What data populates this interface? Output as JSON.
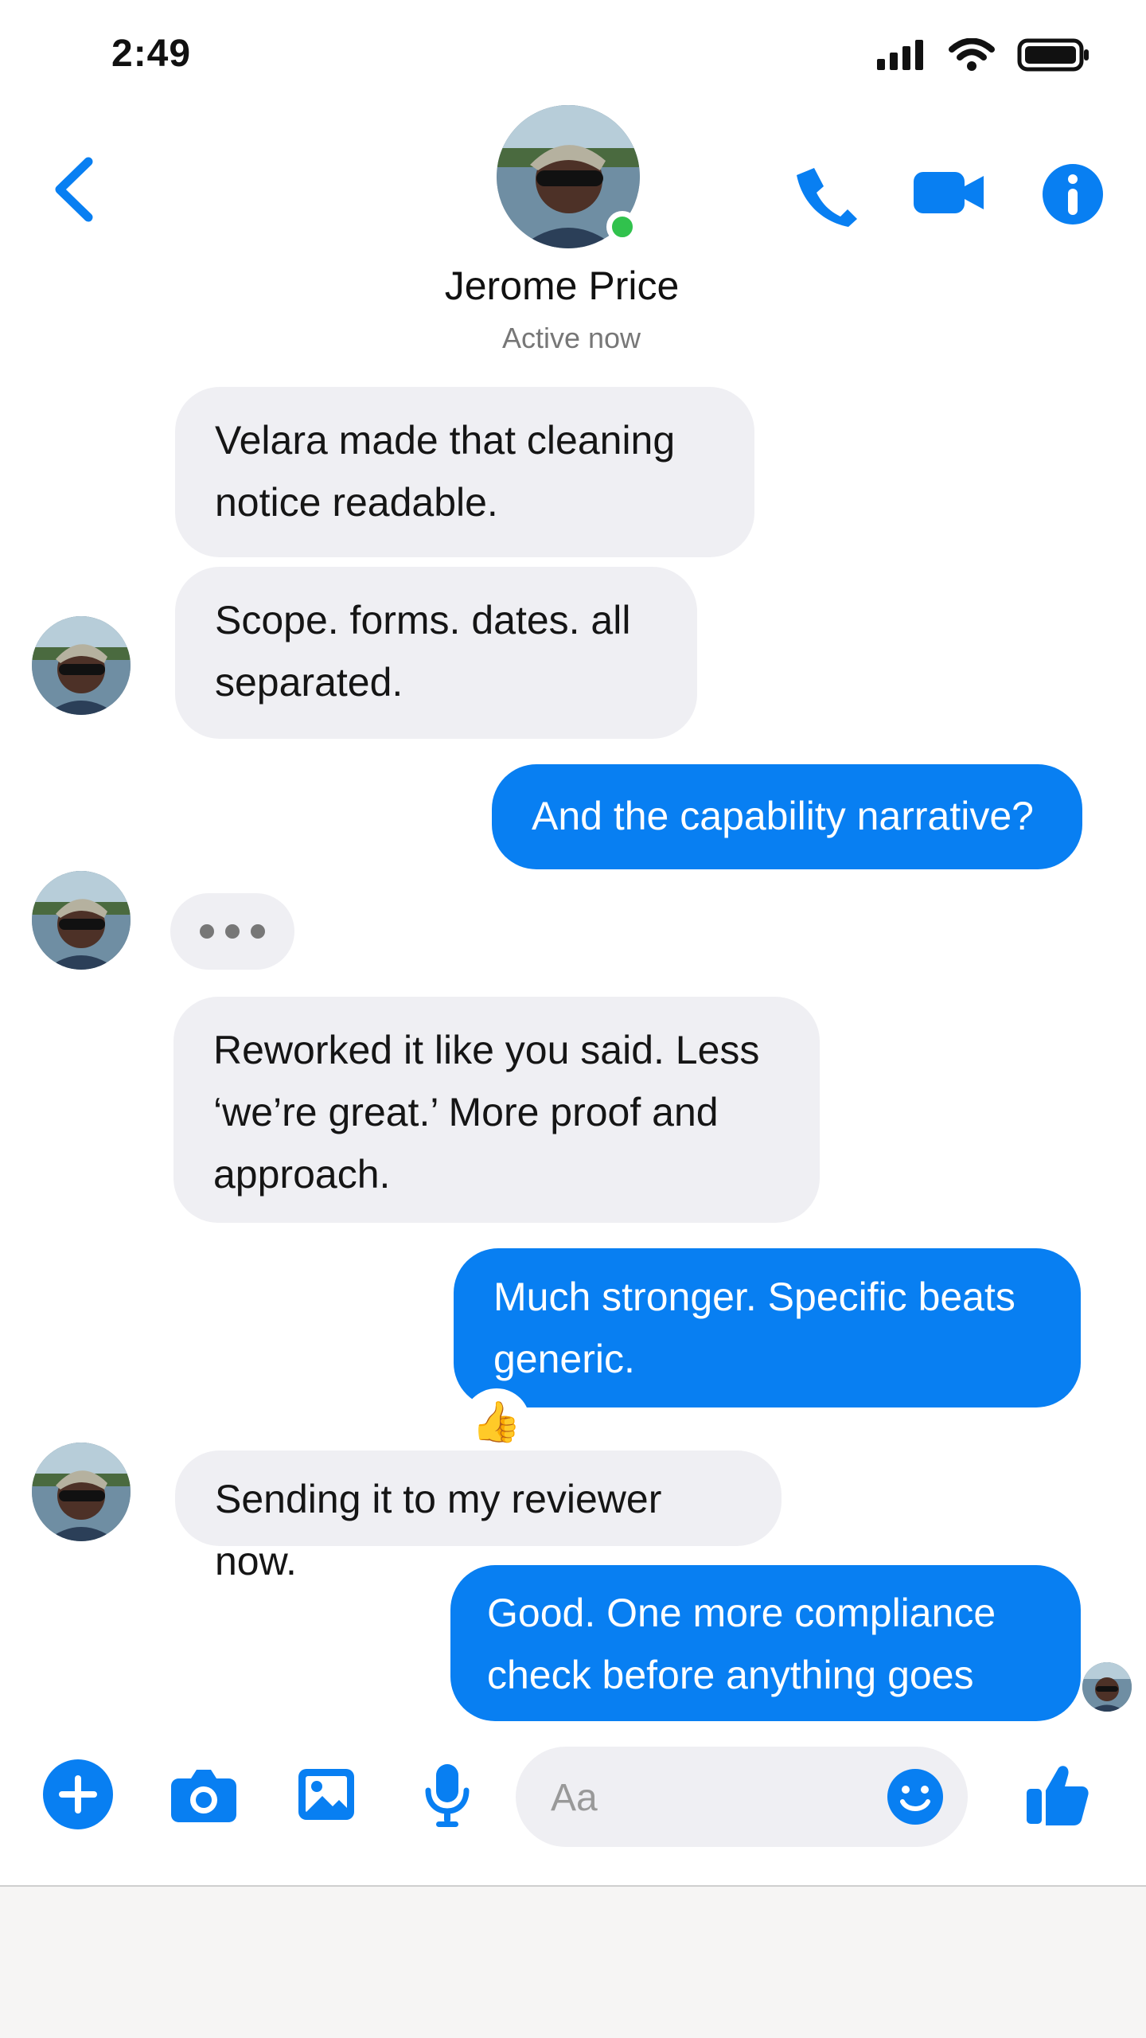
{
  "status": {
    "time": "2:49",
    "signal_icon": "signal-icon",
    "wifi_icon": "wifi-icon",
    "battery_icon": "battery-icon"
  },
  "header": {
    "contact_name": "Jerome Price",
    "contact_status": "Active now",
    "back_icon": "chevron-left-icon",
    "call_icon": "phone-icon",
    "video_icon": "video-icon",
    "info_icon": "info-icon",
    "accent": "#087ff2",
    "online_color": "#31c24d"
  },
  "messages": [
    {
      "text": "Velara made that cleaning\nnotice readable.",
      "direction": "incoming"
    },
    {
      "text": "Scope. forms. dates. all\nseparated.",
      "direction": "incoming"
    },
    {
      "text": "And the capability narrative?",
      "direction": "outgoing"
    },
    {
      "text": "•••",
      "direction": "incoming"
    },
    {
      "text": "Reworked it like you said. Less\n‘we’re great.’ More proof and\napproach.",
      "direction": "incoming"
    },
    {
      "text": "Much stronger. Specific beats\ngeneric.",
      "direction": "outgoing"
    },
    {
      "text": "Sending it to my reviewer now.",
      "direction": "incoming"
    },
    {
      "text": "Good. One more compliance\ncheck before anything goes out.",
      "direction": "outgoing"
    }
  ],
  "reaction": {
    "emoji": "👍"
  },
  "composer": {
    "placeholder": "Aa",
    "plus_icon": "plus-icon",
    "camera_icon": "camera-icon",
    "gallery_icon": "image-icon",
    "mic_icon": "microphone-icon",
    "emoji_icon": "smiley-icon",
    "like_icon": "thumbs-up-icon"
  }
}
